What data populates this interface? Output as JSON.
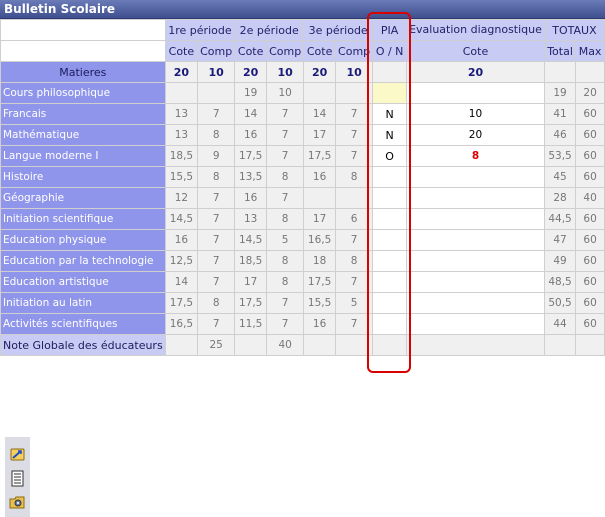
{
  "window": {
    "title": "Bulletin Scolaire"
  },
  "header": {
    "periods": [
      "1re période",
      "2e période",
      "3e période"
    ],
    "pia": "PIA",
    "evaluation": "Evaluation diagnostique",
    "totaux": "TOTAUX",
    "cote": "Cote",
    "comp": "Comp",
    "pia_sub": "O / N",
    "total": "Total",
    "max": "Max"
  },
  "max_row": {
    "label": "Matieres",
    "values": [
      "20",
      "10",
      "20",
      "10",
      "20",
      "10",
      "",
      "20",
      "",
      ""
    ]
  },
  "rows": [
    {
      "subject": "Cours philosophique",
      "cells": [
        "",
        "",
        "19",
        "10",
        "",
        "",
        "",
        "",
        "19",
        "20"
      ]
    },
    {
      "subject": "Francais",
      "cells": [
        "13",
        "7",
        "14",
        "7",
        "14",
        "7",
        "N",
        "10",
        "41",
        "60"
      ]
    },
    {
      "subject": "Mathématique",
      "cells": [
        "13",
        "8",
        "16",
        "7",
        "17",
        "7",
        "N",
        "20",
        "46",
        "60"
      ]
    },
    {
      "subject": "Langue moderne I",
      "cells": [
        "18,5",
        "9",
        "17,5",
        "7",
        "17,5",
        "7",
        "O",
        "8",
        "53,5",
        "60"
      ]
    },
    {
      "subject": "Histoire",
      "cells": [
        "15,5",
        "8",
        "13,5",
        "8",
        "16",
        "8",
        "",
        "",
        "45",
        "60"
      ]
    },
    {
      "subject": "Géographie",
      "cells": [
        "12",
        "7",
        "16",
        "7",
        "",
        "",
        "",
        "",
        "28",
        "40"
      ]
    },
    {
      "subject": "Initiation scientifique",
      "cells": [
        "14,5",
        "7",
        "13",
        "8",
        "17",
        "6",
        "",
        "",
        "44,5",
        "60"
      ]
    },
    {
      "subject": "Education physique",
      "cells": [
        "16",
        "7",
        "14,5",
        "5",
        "16,5",
        "7",
        "",
        "",
        "47",
        "60"
      ]
    },
    {
      "subject": "Education par la technologie",
      "cells": [
        "12,5",
        "7",
        "18,5",
        "8",
        "18",
        "8",
        "",
        "",
        "49",
        "60"
      ]
    },
    {
      "subject": "Education artistique",
      "cells": [
        "14",
        "7",
        "17",
        "8",
        "17,5",
        "7",
        "",
        "",
        "48,5",
        "60"
      ]
    },
    {
      "subject": "Initiation au latin",
      "cells": [
        "17,5",
        "8",
        "17,5",
        "7",
        "15,5",
        "5",
        "",
        "",
        "50,5",
        "60"
      ]
    },
    {
      "subject": "Activités scientifiques",
      "cells": [
        "16,5",
        "7",
        "11,5",
        "7",
        "16",
        "7",
        "",
        "",
        "44",
        "60"
      ]
    }
  ],
  "footer": {
    "label": "Note Globale des éducateurs",
    "cells": [
      "",
      "25",
      "",
      "40",
      "",
      "",
      "",
      "",
      "",
      ""
    ]
  },
  "colors": {
    "title_bar": "#3f4f8f",
    "subject_bg": "#8f95ea",
    "header_bg": "#c8cbf4",
    "highlight": "#d90000",
    "red_value": "#e00000"
  },
  "toolbar": {
    "icons": [
      "refresh-icon",
      "list-document-icon",
      "settings-folder-icon"
    ]
  }
}
